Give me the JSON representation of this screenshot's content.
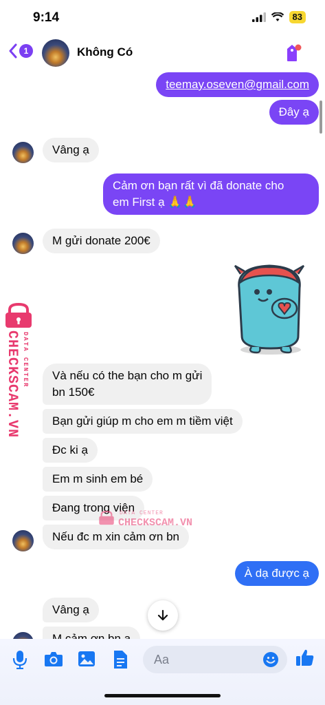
{
  "status": {
    "time": "9:14",
    "battery": "83"
  },
  "header": {
    "back_badge": "1",
    "contact_name": "Không Có"
  },
  "messages": {
    "m1": "teemay.oseven@gmail.com",
    "m2": "Đây ạ",
    "m3": "Vâng ạ",
    "m4_line1": "Cảm ơn bạn rất vì đã donate cho",
    "m4_line2": "em First ạ 🙏🙏",
    "m5": "M gửi donate 200€",
    "m6_line1": "Và nếu có the bạn cho m gửi",
    "m6_line2": "bn 150€",
    "m7": "Bạn gửi giúp m cho em m tiềm việt",
    "m8": "Đc ki ạ",
    "m9": "Em m sinh em bé",
    "m10": "Đang trong viện",
    "m11": "Nếu đc m xin cảm ơn bn",
    "m12": "À dạ được ạ",
    "m13": "Vâng ạ",
    "m14": "M cảm ơn bn a"
  },
  "watermark": {
    "brand": "CHECKSCAM.VN",
    "sub": "DATA CENTER"
  },
  "composer": {
    "placeholder": "Aa"
  },
  "colors": {
    "outgoing": "#7a45f5",
    "outgoing_blue": "#2f6ff5",
    "incoming": "#f0f0f0",
    "accent": "#1877f2",
    "watermark": "#e83a6e"
  }
}
